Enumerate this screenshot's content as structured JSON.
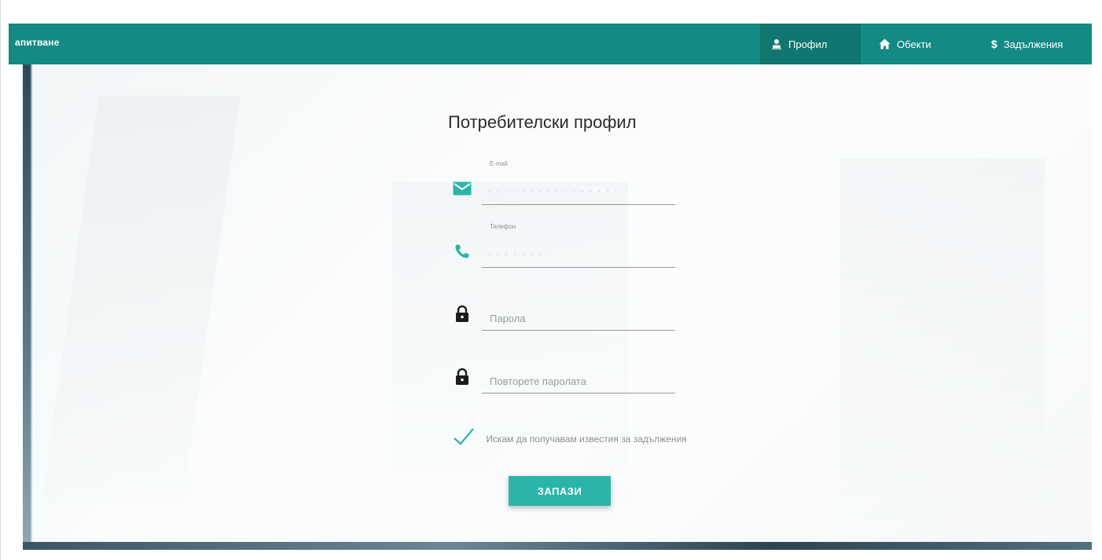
{
  "navbar": {
    "brand": "апитване",
    "items": [
      {
        "label": "Профил",
        "icon": "user-icon",
        "active": true
      },
      {
        "label": "Обекти",
        "icon": "home-icon",
        "active": false
      },
      {
        "label": "Задължения",
        "icon": "dollar-icon",
        "symbol": "$",
        "active": false
      }
    ],
    "bg_color": "#138a83",
    "active_color": "#0f7670"
  },
  "form": {
    "title": "Потребителски профил",
    "fields": [
      {
        "label": "E-mail",
        "icon": "mail-icon",
        "value": "· · · · · · · · · · · · · · · ·"
      },
      {
        "label": "Телефон",
        "icon": "phone-icon",
        "value": "· · · · · · ·"
      },
      {
        "placeholder": "Парола",
        "icon": "lock-icon",
        "value": ""
      },
      {
        "placeholder": "Повторете паролата",
        "icon": "lock-icon",
        "value": ""
      }
    ],
    "notification_checkbox": {
      "label": "Искам да получавам известия за задължения",
      "checked": true
    },
    "save_label": "ЗАПАЗИ",
    "accent_color": "#2bb5a8"
  }
}
